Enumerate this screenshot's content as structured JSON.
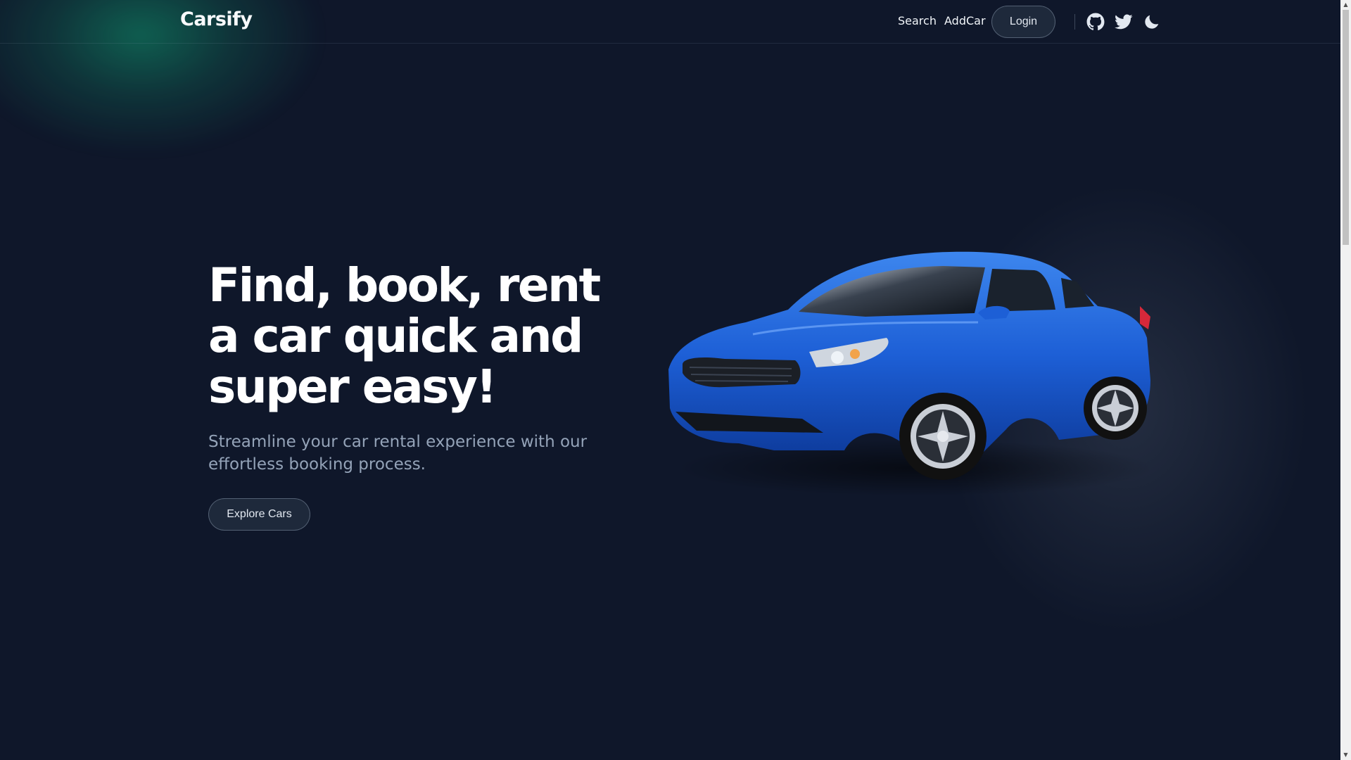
{
  "header": {
    "logo": "Carsify",
    "nav": {
      "search": "Search",
      "addcar": "AddCar"
    },
    "login_label": "Login",
    "icons": [
      "github-icon",
      "twitter-icon",
      "moon-icon"
    ]
  },
  "hero": {
    "title": "Find, book, rent a car quick and super easy!",
    "subtitle": "Streamline your car rental experience with our effortless booking process.",
    "cta_label": "Explore Cars"
  },
  "colors": {
    "background": "#0f172a",
    "accent_glow": "#10b981",
    "car_blue": "#1d5fd6",
    "muted_text": "#94a3b8"
  }
}
